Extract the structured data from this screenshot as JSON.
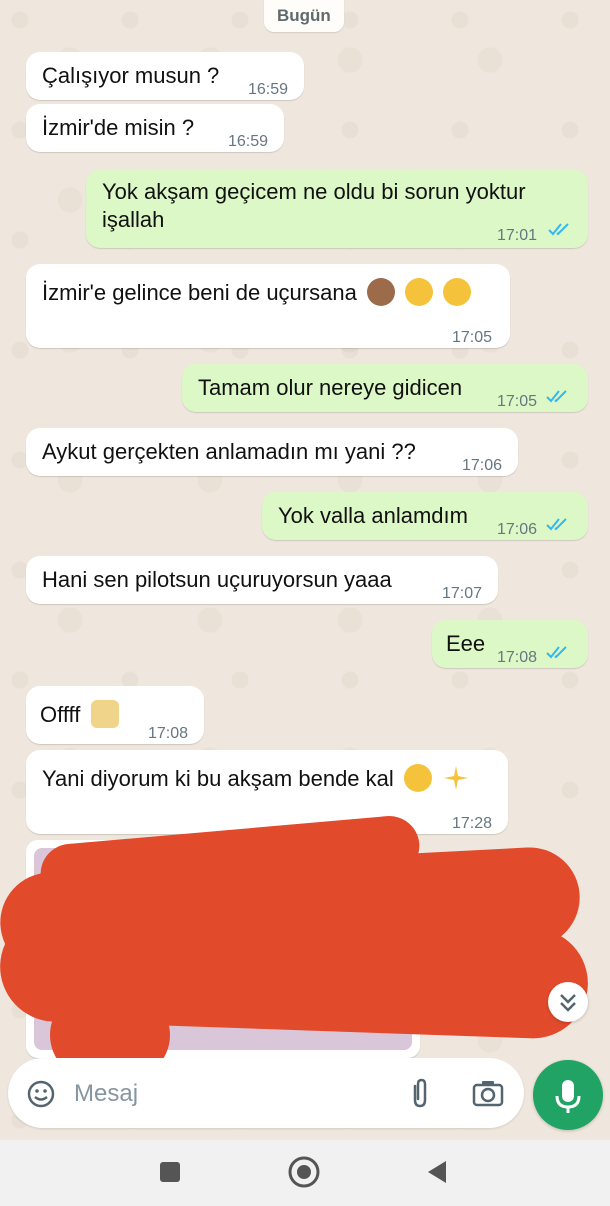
{
  "date_label": "Bugün",
  "messages": [
    {
      "dir": "in",
      "text": "Çalışıyor musun ?",
      "time": "16:59"
    },
    {
      "dir": "in",
      "text": "İzmir'de misin ?",
      "time": "16:59"
    },
    {
      "dir": "out",
      "text": "Yok akşam geçicem ne oldu bi sorun yoktur",
      "text2": "işallah",
      "time": "17:01",
      "status": "read"
    },
    {
      "dir": "in",
      "text": "İzmir'e gelince beni de uçursana",
      "emojis": [
        "see-no-evil-monkey",
        "hushed-face",
        "kissing-face"
      ],
      "time": "17:05"
    },
    {
      "dir": "out",
      "text": "Tamam olur nereye gidicen",
      "time": "17:05",
      "status": "read"
    },
    {
      "dir": "in",
      "text": "Aykut gerçekten anlamadın mı yani ??",
      "time": "17:06"
    },
    {
      "dir": "out",
      "text": "Yok valla anlamdım",
      "time": "17:06",
      "status": "read"
    },
    {
      "dir": "in",
      "text": "Hani sen pilotsun uçuruyorsun yaaa",
      "time": "17:07"
    },
    {
      "dir": "out",
      "text": "Eee",
      "time": "17:08",
      "status": "read"
    },
    {
      "dir": "in",
      "text": "Offff",
      "emojis": [
        "facepalm"
      ],
      "time": "17:08"
    },
    {
      "dir": "in",
      "text": "Yani diyorum ki bu akşam bende kal",
      "emojis": [
        "crescent-moon",
        "sparkles"
      ],
      "time": "17:28"
    }
  ],
  "composer": {
    "placeholder": "Mesaj",
    "icons": [
      "emoji-icon",
      "attach-icon",
      "camera-icon",
      "mic-icon"
    ]
  },
  "colors": {
    "incoming_bubble": "#ffffff",
    "outgoing_bubble": "#dcf8c6",
    "read_ticks": "#34b7f1",
    "mic_button": "#21a366",
    "redaction": "#e24a2c"
  },
  "nav": {
    "icons": [
      "recent-apps-icon",
      "home-icon",
      "back-icon"
    ]
  }
}
